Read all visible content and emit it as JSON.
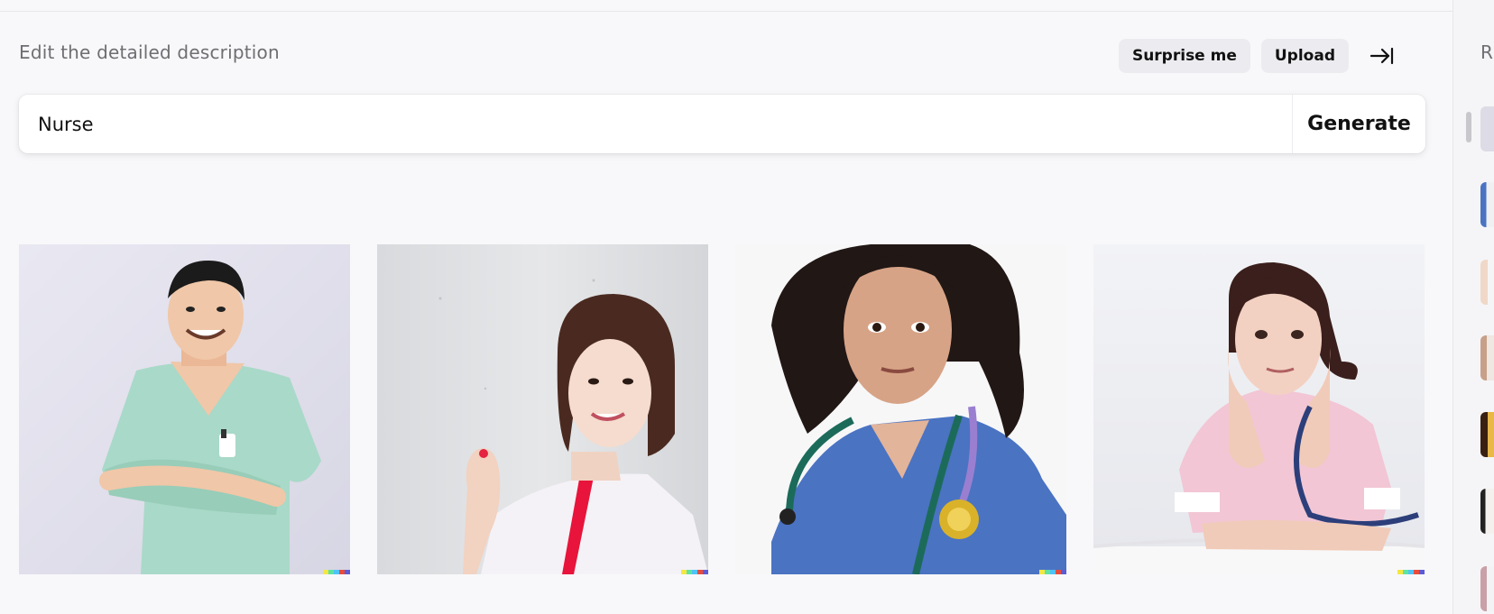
{
  "editor": {
    "heading": "Edit the detailed description",
    "actions": {
      "surprise_label": "Surprise me",
      "upload_label": "Upload",
      "collapse_icon": "arrow-right-to-line-icon"
    },
    "prompt": {
      "value": "Nurse",
      "generate_label": "Generate"
    }
  },
  "results": [
    {
      "subject": "Smiling man in mint green scrubs with arms crossed"
    },
    {
      "subject": "Smiling woman with bob haircut in white nurse uniform with red trim"
    },
    {
      "subject": "Woman with curly dark hair in blue scrubs with stethoscope"
    },
    {
      "subject": "Woman in pink nurse uniform resting chin on hands with stethoscope"
    }
  ],
  "signature_colors": [
    "#f5e642",
    "#5ee3a2",
    "#4fc3f7",
    "#e74c3c",
    "#5b5bd6"
  ],
  "history_sidebar": {
    "title": "R",
    "thumbnail_count": 8
  }
}
